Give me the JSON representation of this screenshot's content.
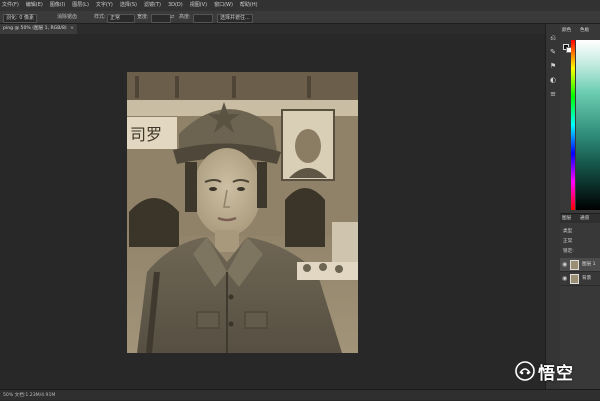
{
  "menubar": {
    "items": [
      "文件(F)",
      "编辑(E)",
      "图像(I)",
      "图层(L)",
      "文字(Y)",
      "选择(S)",
      "滤镜(T)",
      "3D(D)",
      "视图(V)",
      "窗口(W)",
      "帮助(H)"
    ]
  },
  "options": {
    "tool_size": "羽化: 0 像素",
    "anti_alias": "消除锯齿",
    "style_label": "样式:",
    "style_value": "正常",
    "width_label": "宽度:",
    "height_label": "高度:",
    "refine": "选择并遮住..."
  },
  "document": {
    "tab_title": "ping @ 50% (图层 1, RGB/8)",
    "tab_close": "×"
  },
  "status": {
    "text": "50% 文档:1.23M/4.91M"
  },
  "panels": {
    "color_tab": "颜色",
    "swatches_tab": "色板",
    "layers_tab": "图层",
    "channels_tab": "通道",
    "kind_label": "类型",
    "blend_mode": "正常",
    "lock_label": "锁定:",
    "layers": [
      {
        "name": "图层 1",
        "selected": true
      },
      {
        "name": "背景",
        "selected": false
      }
    ]
  },
  "watermark": {
    "text": "悟空"
  }
}
